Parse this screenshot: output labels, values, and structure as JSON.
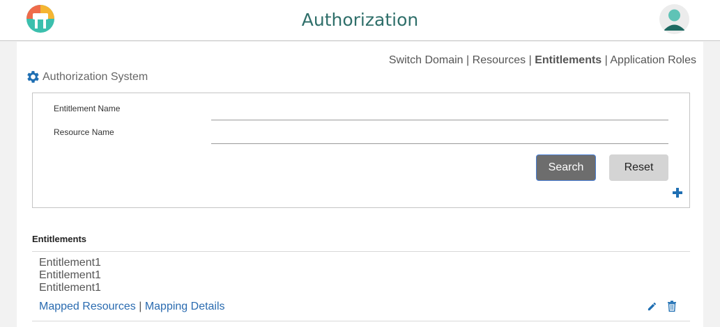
{
  "header": {
    "title": "Authorization"
  },
  "nav": {
    "links": [
      "Switch Domain",
      "Resources",
      "Entitlements",
      "Application Roles"
    ],
    "separator": "|",
    "active": "Entitlements"
  },
  "system": {
    "title": "Authorization System"
  },
  "search_form": {
    "entitlement_label": "Entitlement Name",
    "entitlement_value": "",
    "resource_label": "Resource Name",
    "resource_value": "",
    "search_button": "Search",
    "reset_button": "Reset"
  },
  "results": {
    "heading": "Entitlements",
    "entries": [
      "Entitlement1",
      "Entitlement1",
      "Entitlement1"
    ],
    "link_mapped_resources": "Mapped Resources",
    "link_separator": "|",
    "link_mapping_details": "Mapping Details"
  },
  "icons": {
    "logo": "app-logo-icon",
    "avatar": "user-avatar-icon",
    "gear": "gear-icon",
    "add": "plus-icon",
    "edit": "pencil-icon",
    "delete": "trash-icon"
  },
  "colors": {
    "accent_teal": "#2f6f6a",
    "link_blue": "#2a6bb0",
    "icon_blue": "#1f6fb3",
    "search_button": "#6d6d6d",
    "reset_button": "#d4d4d4"
  }
}
